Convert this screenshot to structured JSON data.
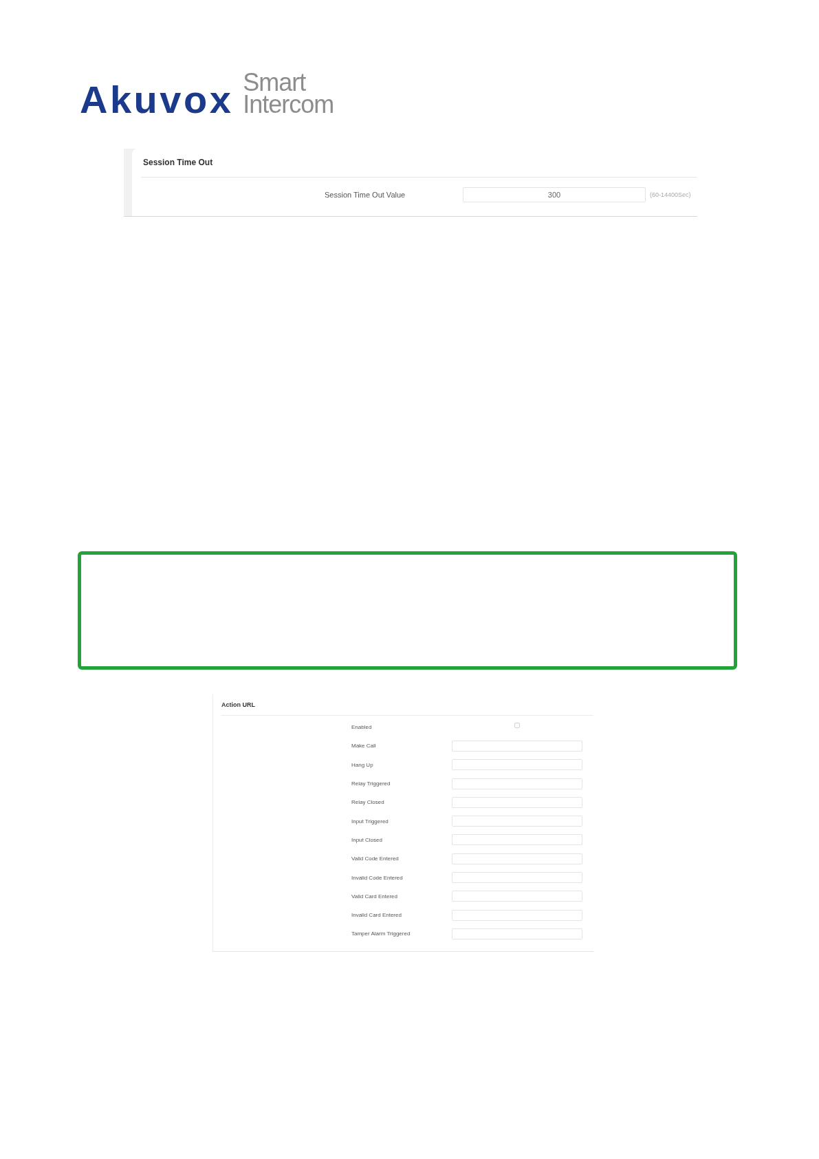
{
  "logo": {
    "brand": "Akuvox",
    "tagline": "Smart Intercom"
  },
  "session_timeout": {
    "title": "Session Time Out",
    "fields": [
      {
        "label": "Session Time Out Value",
        "value": "300",
        "hint": "(60-14400Sec)"
      }
    ]
  },
  "action_url": {
    "title": "Action URL",
    "rows": [
      {
        "kind": "checkbox",
        "label": "Enabled",
        "checked": false
      },
      {
        "kind": "text",
        "label": "Make Call"
      },
      {
        "kind": "text",
        "label": "Hang Up"
      },
      {
        "kind": "text",
        "label": "Relay Triggered"
      },
      {
        "kind": "text",
        "label": "Relay Closed"
      },
      {
        "kind": "text",
        "label": "Input Triggered"
      },
      {
        "kind": "text",
        "label": "Input Closed"
      },
      {
        "kind": "text",
        "label": "Valid Code Entered"
      },
      {
        "kind": "text",
        "label": "Invalid Code Entered"
      },
      {
        "kind": "text",
        "label": "Valid Card Entered"
      },
      {
        "kind": "text",
        "label": "Invalid Card Entered"
      },
      {
        "kind": "text",
        "label": "Tamper Alarm Triggered"
      }
    ]
  }
}
